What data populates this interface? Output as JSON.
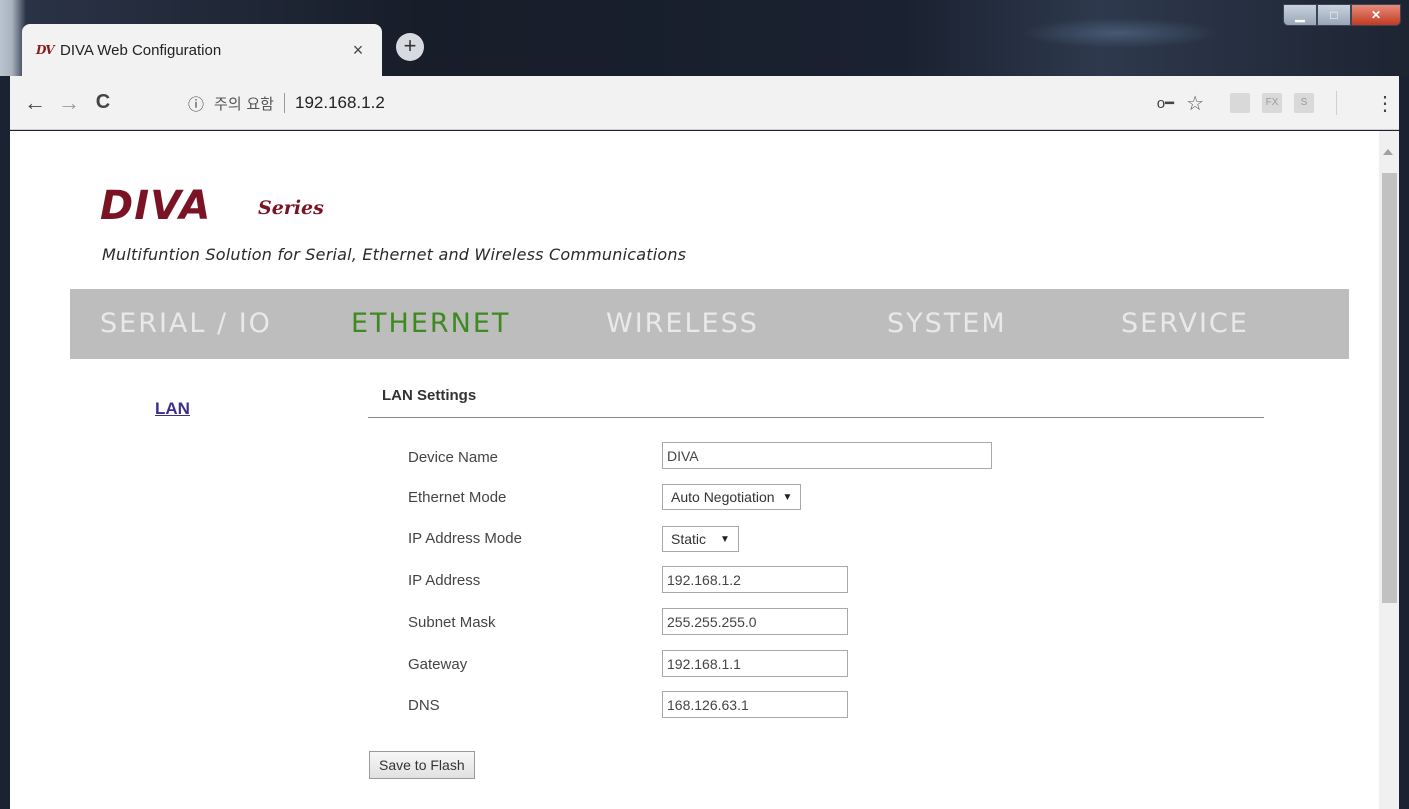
{
  "browser": {
    "tab_favicon": "DV",
    "tab_title": "DIVA Web Configuration",
    "tab_close": "×",
    "new_tab": "+",
    "security_warning": "주의 요함",
    "url": "192.168.1.2",
    "icons": [
      "back-arrow-icon",
      "forward-arrow-icon",
      "reload-icon",
      "info-icon",
      "key-icon",
      "star-icon",
      "menu-dots-icon"
    ],
    "extensions": [
      "",
      "FX",
      "S"
    ]
  },
  "page": {
    "logo": "DIVA",
    "logo_sub": "Series",
    "tagline": "Multifuntion Solution for Serial, Ethernet and Wireless Communications",
    "nav": [
      "SERIAL / IO",
      "ETHERNET",
      "WIRELESS",
      "SYSTEM",
      "SERVICE"
    ],
    "nav_active": "ETHERNET",
    "side_link": "LAN",
    "section_title": "LAN Settings",
    "fields": {
      "device_name": {
        "label": "Device Name",
        "value": "DIVA"
      },
      "ethernet_mode": {
        "label": "Ethernet Mode",
        "value": "Auto Negotiation"
      },
      "ip_mode": {
        "label": "IP Address Mode",
        "value": "Static"
      },
      "ip_address": {
        "label": "IP Address",
        "value": "192.168.1.2"
      },
      "subnet_mask": {
        "label": "Subnet Mask",
        "value": "255.255.255.0"
      },
      "gateway": {
        "label": "Gateway",
        "value": "192.168.1.1"
      },
      "dns": {
        "label": "DNS",
        "value": "168.126.63.1"
      }
    },
    "save_label": "Save to Flash"
  },
  "colors": {
    "logo": "#7a1424",
    "nav_bg": "#bdbdbd",
    "nav_text": "#e9e9e9",
    "nav_active": "#3d8a1e",
    "link": "#3c2f8c"
  }
}
